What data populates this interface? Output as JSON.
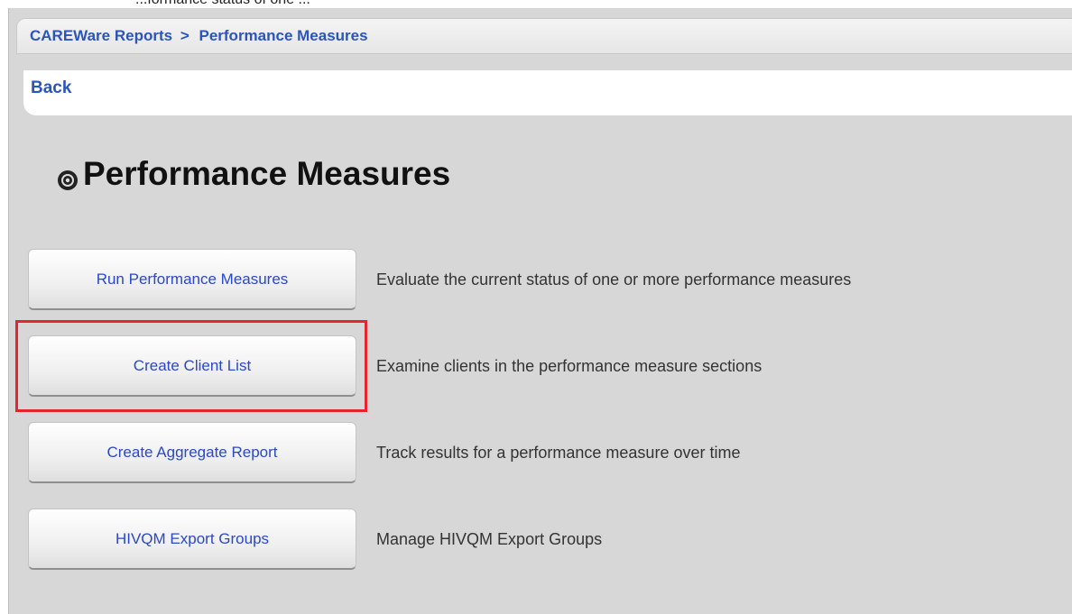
{
  "top_fragment": "...formance  status of one ...",
  "breadcrumb": {
    "root_label": "CAREWare Reports",
    "separator": ">",
    "current_label": "Performance Measures"
  },
  "back_label": "Back",
  "page_title": "Performance Measures",
  "title_icon": "gear-icon",
  "actions": [
    {
      "button_label": "Run Performance Measures",
      "description": "Evaluate the current status of one or more performance measures"
    },
    {
      "button_label": "Create Client List",
      "description": "Examine clients in the performance measure sections",
      "highlighted": true
    },
    {
      "button_label": "Create Aggregate Report",
      "description": "Track results for a performance measure over time"
    },
    {
      "button_label": "HIVQM Export Groups",
      "description": "Manage HIVQM Export Groups"
    }
  ],
  "colors": {
    "link": "#2b55b8",
    "button_text": "#2a48c9",
    "highlight": "#e3262e",
    "panel_background": "#d7d7d7"
  }
}
